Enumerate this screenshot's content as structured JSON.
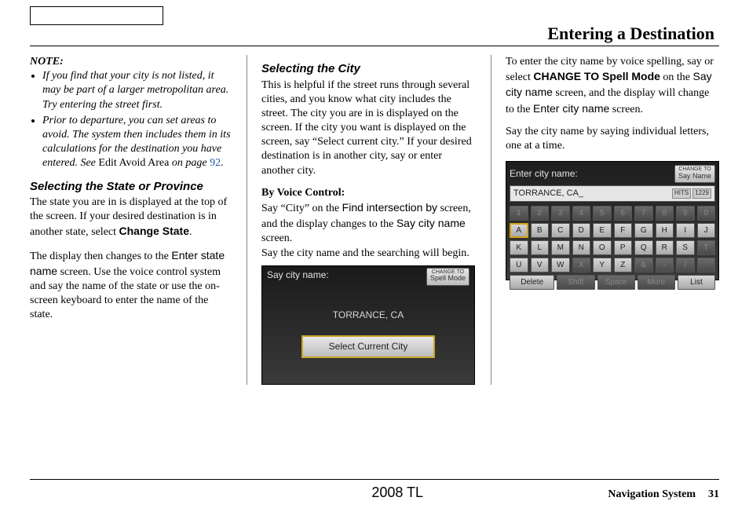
{
  "header": {
    "title": "Entering a Destination"
  },
  "col1": {
    "note_label": "NOTE:",
    "note1": "If you find that your city is not listed, it may be part of a larger metropolitan area. Try entering the street first.",
    "note2a": "Prior to departure, you can set areas to avoid. The system then includes them in its calculations for the destination you have entered. See ",
    "note2b": "Edit Avoid Area",
    "note2c": " on page ",
    "note2d": "92",
    "note2e": ".",
    "head1": "Selecting the State or Province",
    "p1a": "The state you are in is displayed at the top of the screen. If your desired destination is in another state, select ",
    "p1b": "Change State",
    "p1c": ".",
    "p2a": "The display then changes to the ",
    "p2b": "Enter state name",
    "p2c": " screen. Use the voice control system and say the name of the state or use the on-screen keyboard to enter the name of the state."
  },
  "col2": {
    "head1": "Selecting the City",
    "p1": "This is helpful if the street runs through several cities, and you know what city includes the street. The city you are in is displayed on the screen. If the city you want is displayed on the screen, say “Select current city.” If your desired destination is in another city, say or enter another city.",
    "head2": "By Voice Control:",
    "p2a": "Say “City” on the ",
    "p2b": "Find intersection by",
    "p2c": " screen, and the display changes to the ",
    "p2d": "Say city name",
    "p2e": " screen.",
    "p3": "Say the city name and the searching will begin.",
    "screen": {
      "title": "Say city name:",
      "change_sm": "CHANGE TO",
      "change_lg": "Spell Mode",
      "city": "TORRANCE, CA",
      "btn": "Select Current City"
    }
  },
  "col3": {
    "p1a": "To enter the city name by voice spelling, say or select ",
    "p1b": "CHANGE TO Spell Mode",
    "p1c": " on the ",
    "p1d": "Say city name",
    "p1e": " screen, and the display will change to the ",
    "p1f": "Enter city name",
    "p1g": " screen.",
    "p2": "Say the city name by saying individual letters, one at a time.",
    "screen": {
      "title": "Enter city name:",
      "change_sm": "CHANGE TO",
      "change_lg": "Say Name",
      "input": "TORRANCE, CA_",
      "hits_label": "HITS",
      "hits_val": "1229",
      "row1": [
        "1",
        "2",
        "3",
        "4",
        "5",
        "6",
        "7",
        "8",
        "9",
        "0"
      ],
      "row2": [
        "A",
        "B",
        "C",
        "D",
        "E",
        "F",
        "G",
        "H",
        "I",
        "J"
      ],
      "row3": [
        "K",
        "L",
        "M",
        "N",
        "O",
        "P",
        "Q",
        "R",
        "S",
        "T"
      ],
      "row4": [
        "U",
        "V",
        "W",
        "X",
        "Y",
        "Z",
        "&",
        "-",
        "/",
        " "
      ],
      "bottom": {
        "delete": "Delete",
        "shift": "Shift",
        "space": "Space",
        "more": "More",
        "list": "List"
      },
      "dim_row1": [
        0,
        1,
        2,
        3,
        4,
        5,
        6,
        7,
        8,
        9
      ],
      "dim_row2": [],
      "dim_row3": [
        9
      ],
      "dim_row4": [
        3,
        6,
        7,
        8,
        9
      ],
      "hl": {
        "row": 2,
        "col": 0
      }
    }
  },
  "footer": {
    "model": "2008  TL",
    "navsys": "Navigation System",
    "pageno": "31"
  }
}
